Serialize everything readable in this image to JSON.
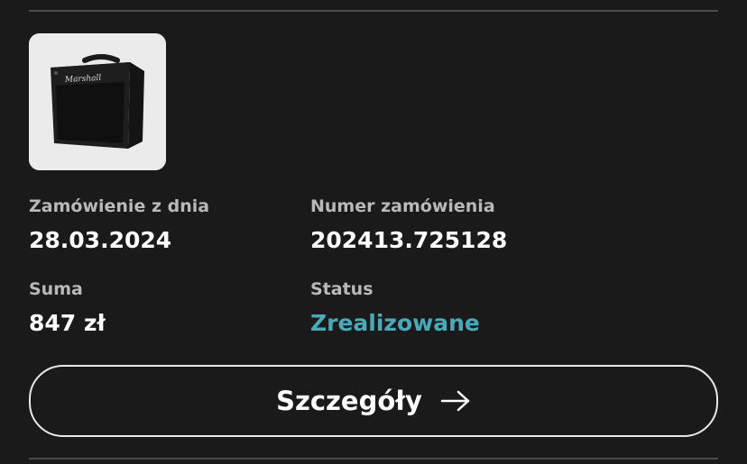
{
  "order": {
    "product_image": "marshall-amp-thumbnail",
    "product_brand_logo": "Marshall",
    "date_label": "Zamówienie z dnia",
    "date_value": "28.03.2024",
    "number_label": "Numer zamówienia",
    "number_value": "202413.725128",
    "sum_label": "Suma",
    "sum_value": "847 zł",
    "status_label": "Status",
    "status_value": "Zrealizowane",
    "status_color": "#4aa9b9"
  },
  "actions": {
    "details_label": "Szczegóły",
    "details_icon": "arrow-right-icon"
  },
  "colors": {
    "background": "#1b1a1b",
    "label": "#b9b8ba",
    "value": "#ffffff",
    "divider": "#4a494b"
  }
}
